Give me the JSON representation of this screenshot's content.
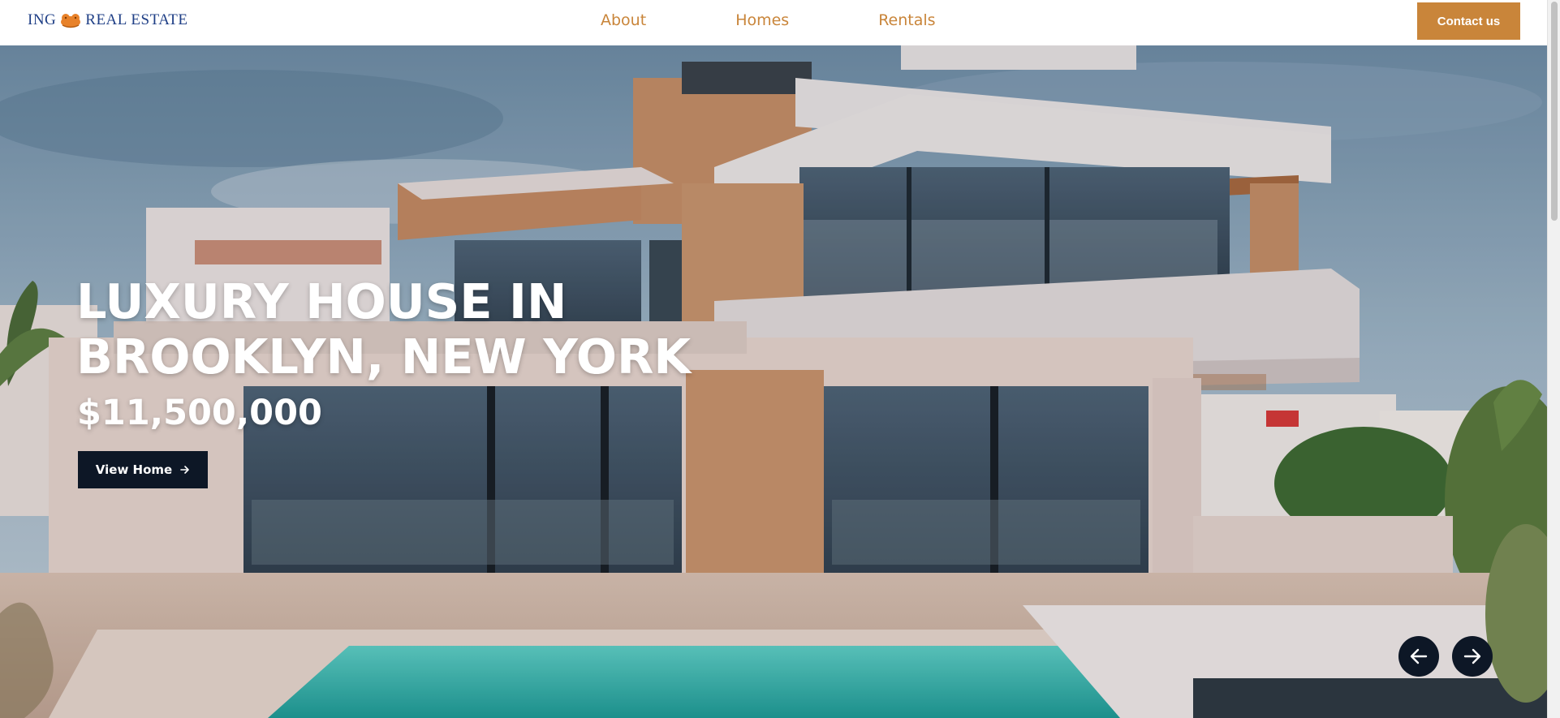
{
  "header": {
    "logo_left": "ING",
    "logo_right": "REAL ESTATE",
    "nav": [
      "About",
      "Homes",
      "Rentals"
    ],
    "contact_label": "Contact us"
  },
  "hero": {
    "title_line1": "LUXURY HOUSE IN",
    "title_line2": "BROOKLYN, NEW YORK",
    "price": "$11,500,000",
    "view_label": "View Home"
  },
  "colors": {
    "brand_orange": "#c9853a",
    "logo_blue": "#1f3f86",
    "dark_navy": "#0d1726"
  },
  "icons": {
    "logo": "lion-icon",
    "view_arrow": "arrow-right-icon",
    "prev": "arrow-left-icon",
    "next": "arrow-right-icon"
  }
}
